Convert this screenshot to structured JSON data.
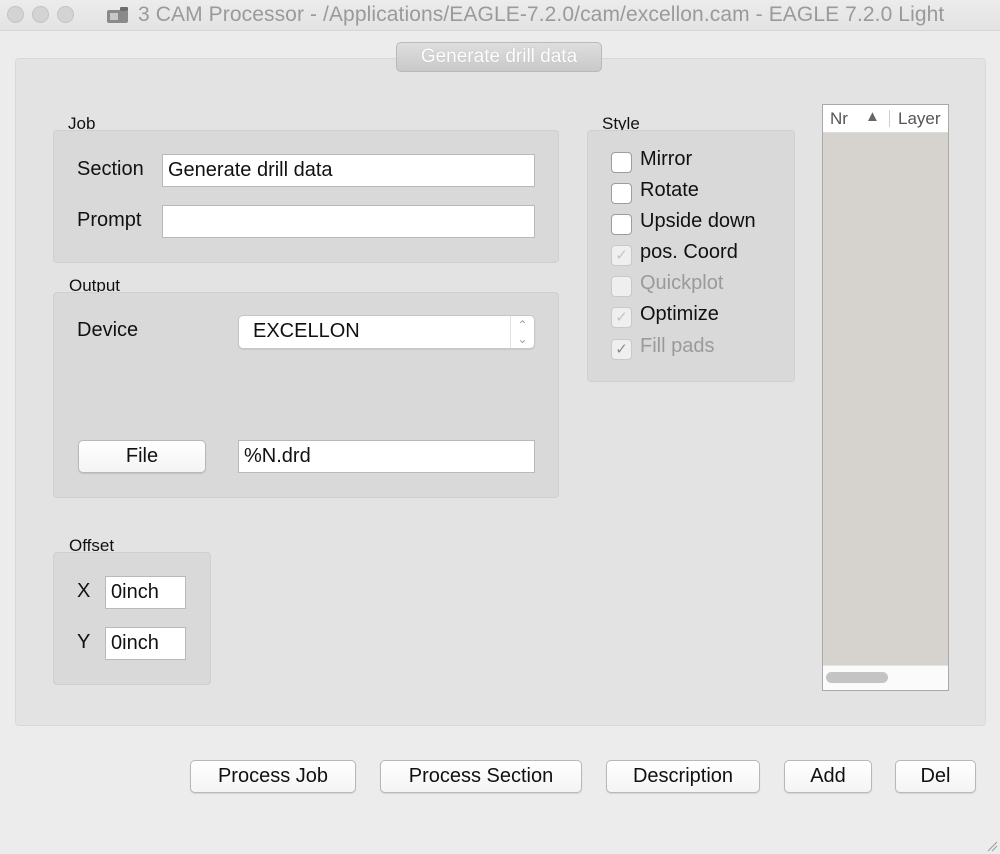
{
  "window": {
    "title": "3 CAM Processor - /Applications/EAGLE-7.2.0/cam/excellon.cam - EAGLE 7.2.0 Light"
  },
  "tab": {
    "label": "Generate drill data"
  },
  "job": {
    "group_label": "Job",
    "section_label": "Section",
    "section_value": "Generate drill data",
    "prompt_label": "Prompt",
    "prompt_value": ""
  },
  "output": {
    "group_label": "Output",
    "device_label": "Device",
    "device_value": "EXCELLON",
    "file_button": "File",
    "file_value": "%N.drd"
  },
  "offset": {
    "group_label": "Offset",
    "x_label": "X",
    "x_value": "0inch",
    "y_label": "Y",
    "y_value": "0inch"
  },
  "style": {
    "group_label": "Style",
    "options": [
      {
        "label": "Mirror",
        "checked": false,
        "enabled": true
      },
      {
        "label": "Rotate",
        "checked": false,
        "enabled": true
      },
      {
        "label": "Upside down",
        "checked": false,
        "enabled": true
      },
      {
        "label": "pos. Coord",
        "checked": true,
        "enabled": true
      },
      {
        "label": "Quickplot",
        "checked": false,
        "enabled": false
      },
      {
        "label": "Optimize",
        "checked": true,
        "enabled": true
      },
      {
        "label": "Fill pads",
        "checked": true,
        "enabled": false
      }
    ]
  },
  "layer_list": {
    "col_nr": "Nr",
    "sort_indicator": "▲",
    "col_layer": "Layer"
  },
  "buttons": {
    "process_job": "Process Job",
    "process_section": "Process Section",
    "description": "Description",
    "add": "Add",
    "del": "Del"
  }
}
